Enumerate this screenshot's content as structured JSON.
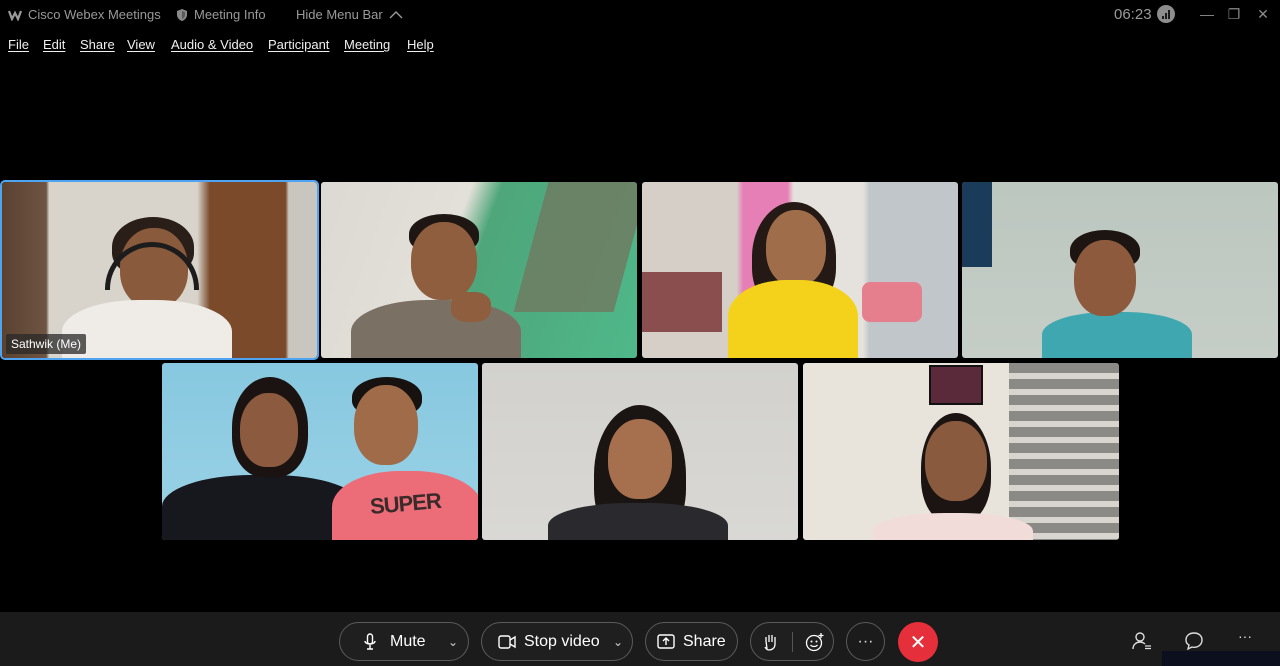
{
  "titlebar": {
    "app_name": "Cisco Webex Meetings",
    "meeting_info": "Meeting Info",
    "hide_menu": "Hide Menu Bar",
    "time": "06:23",
    "minimize": "—",
    "restore": "❐",
    "close": "✕"
  },
  "menu": {
    "items": [
      "File",
      "Edit",
      "Share",
      "View",
      "Audio & Video",
      "Participant",
      "Meeting",
      "Help"
    ]
  },
  "participants": {
    "self_label": "Sathwik (Me)",
    "shirt_text": "SUPER"
  },
  "controls": {
    "mute": "Mute",
    "stop_video": "Stop video",
    "share": "Share",
    "more": "···"
  },
  "colors": {
    "accent_border": "#4ea4f0",
    "end_call": "#e52f3a",
    "control_bg": "#1b1b1b"
  }
}
